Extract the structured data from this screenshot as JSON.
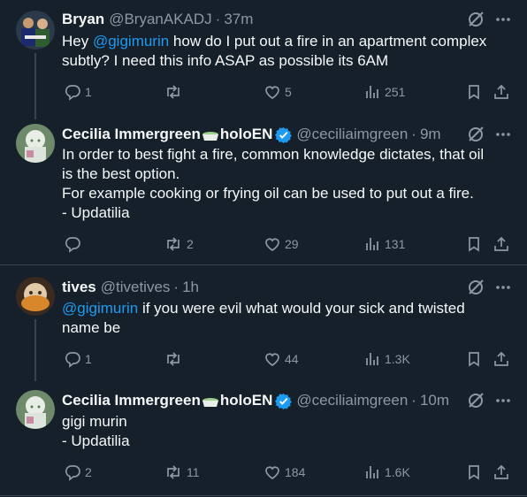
{
  "colors": {
    "background": "#15202b",
    "text_primary": "#f7f9f9",
    "text_secondary": "#8b98a5",
    "mention": "#1d9bf0",
    "verified": "#1d9bf0",
    "divider": "#38444d"
  },
  "tweets": [
    {
      "display_name": "Bryan",
      "handle": "@BryanAKADJ",
      "time": "37m",
      "verified": false,
      "emoji": "",
      "name_suffix": "",
      "lines": [
        {
          "mention": "@gigimurin",
          "pre": "Hey ",
          "post": " how do I put out a fire in an apartment complex"
        },
        {
          "mention": "",
          "pre": "subtly? I need this info ASAP as possible its 6AM",
          "post": ""
        }
      ],
      "replies": "1",
      "retweets": "",
      "likes": "5",
      "views": "251"
    },
    {
      "display_name": "Cecilia Immergreen",
      "name_suffix": "holoEN",
      "handle": "@ceciliaimgreen",
      "time": "9m",
      "verified": true,
      "emoji": "green-tea-icon",
      "lines": [
        {
          "mention": "",
          "pre": "In order to best fight a fire, common knowledge dictates, that oil",
          "post": ""
        },
        {
          "mention": "",
          "pre": "is the best option.",
          "post": ""
        },
        {
          "mention": "",
          "pre": "For example cooking or frying oil can be used to put out a fire.",
          "post": ""
        },
        {
          "mention": "",
          "pre": "- Updatilia",
          "post": ""
        }
      ],
      "replies": "",
      "retweets": "2",
      "likes": "29",
      "views": "131"
    },
    {
      "display_name": "tives",
      "handle": "@tivetives",
      "time": "1h",
      "verified": false,
      "emoji": "",
      "name_suffix": "",
      "lines": [
        {
          "mention": "@gigimurin",
          "pre": "",
          "post": " if you were evil what would your sick and twisted"
        },
        {
          "mention": "",
          "pre": "name be",
          "post": ""
        }
      ],
      "replies": "1",
      "retweets": "",
      "likes": "44",
      "views": "1.3K"
    },
    {
      "display_name": "Cecilia Immergreen",
      "name_suffix": "holoEN",
      "handle": "@ceciliaimgreen",
      "time": "10m",
      "verified": true,
      "emoji": "green-tea-icon",
      "lines": [
        {
          "mention": "",
          "pre": "gigi murin",
          "post": ""
        },
        {
          "mention": "",
          "pre": "- Updatilia",
          "post": ""
        }
      ],
      "replies": "2",
      "retweets": "11",
      "likes": "184",
      "views": "1.6K"
    }
  ]
}
